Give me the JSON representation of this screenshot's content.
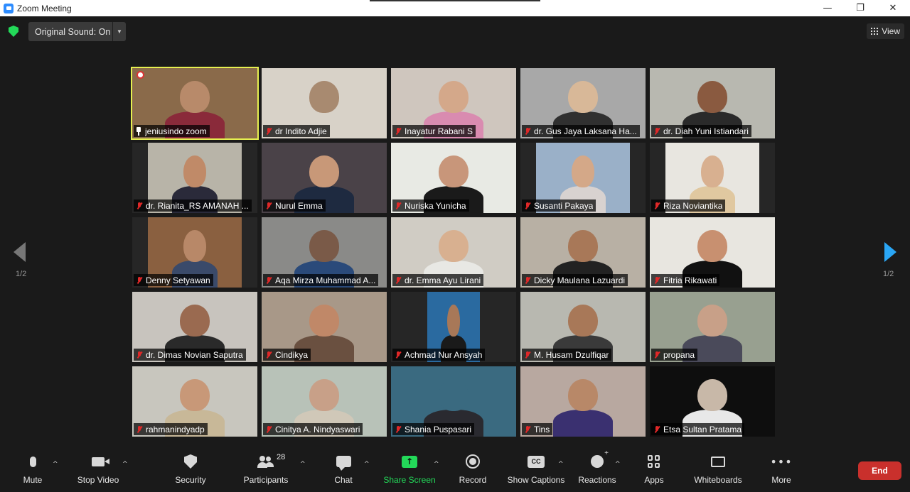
{
  "window": {
    "title": "Zoom Meeting",
    "minimize_glyph": "—",
    "restore_glyph": "❐",
    "close_glyph": "✕"
  },
  "topbar": {
    "original_sound_label": "Original Sound: On",
    "view_label": "View"
  },
  "gallery": {
    "page_indicator_left": "1/2",
    "page_indicator_right": "1/2",
    "participants": [
      {
        "name": "jeniusindo zoom",
        "muted": false,
        "pinned": true,
        "active_speaker": true,
        "bg": "#8a6a4a",
        "skin": "#b88a6a",
        "shirt": "#8a2a3a",
        "layout": "full"
      },
      {
        "name": "dr Indito Adjie",
        "muted": true,
        "bg": "#d8d2c8",
        "skin": "#a88a70",
        "shirt": "#d8d2c8",
        "layout": "full"
      },
      {
        "name": "Inayatur Rabani S",
        "muted": true,
        "bg": "#cfc6be",
        "skin": "#d4a88a",
        "shirt": "#d98bb0",
        "layout": "full"
      },
      {
        "name": "dr. Gus Jaya Laksana Ha...",
        "muted": true,
        "bg": "#a8a8a8",
        "skin": "#d8b898",
        "shirt": "#303030",
        "layout": "full"
      },
      {
        "name": "dr. Diah Yuni Istiandari",
        "muted": true,
        "bg": "#b8b8b0",
        "skin": "#8a5a40",
        "shirt": "#2a2a2a",
        "layout": "full"
      },
      {
        "name": "dr. Rianita_RS AMANAH ...",
        "muted": true,
        "bg": "#b8b4a8",
        "skin": "#c08a68",
        "shirt": "#2a2a3a",
        "layout": "narrow"
      },
      {
        "name": "Nurul Emma",
        "muted": true,
        "bg": "#4a4248",
        "skin": "#c89878",
        "shirt": "#1e2a40",
        "layout": "full"
      },
      {
        "name": "Nuriska Yunicha",
        "muted": true,
        "bg": "#e8eae4",
        "skin": "#c8967a",
        "shirt": "#1a1a1a",
        "layout": "full"
      },
      {
        "name": "Susanti Pakaya",
        "muted": true,
        "bg": "#9ab0c8",
        "skin": "#d4a888",
        "shirt": "#d8d2d0",
        "layout": "narrow"
      },
      {
        "name": "Riza Noviantika",
        "muted": true,
        "bg": "#e8e6e0",
        "skin": "#d8b090",
        "shirt": "#e0c8a0",
        "layout": "narrow"
      },
      {
        "name": "Denny Setyawan",
        "muted": true,
        "bg": "#8a6040",
        "skin": "#b88868",
        "shirt": "#3a4a6a",
        "layout": "narrow"
      },
      {
        "name": "Aqa Mirza Muhammad A...",
        "muted": true,
        "bg": "#8a8a88",
        "skin": "#7a5a48",
        "shirt": "#2a4a7a",
        "layout": "full"
      },
      {
        "name": "dr. Emma Ayu Lirani",
        "muted": true,
        "bg": "#d0ccc4",
        "skin": "#d8b090",
        "shirt": "#e8e8e4",
        "layout": "full"
      },
      {
        "name": "Dicky Maulana Lazuardi",
        "muted": true,
        "bg": "#b8b0a4",
        "skin": "#a87858",
        "shirt": "#222222",
        "layout": "full"
      },
      {
        "name": "Fitria Rikawati",
        "muted": true,
        "bg": "#e8e6e0",
        "skin": "#c89070",
        "shirt": "#111111",
        "layout": "full"
      },
      {
        "name": "dr. Dimas Novian Saputra",
        "muted": true,
        "bg": "#c8c4be",
        "skin": "#9a6a50",
        "shirt": "#2a2a2a",
        "layout": "full"
      },
      {
        "name": "Cindikya",
        "muted": true,
        "bg": "#a89888",
        "skin": "#c08868",
        "shirt": "#6a5040",
        "layout": "full"
      },
      {
        "name": "Achmad Nur Ansyah",
        "muted": true,
        "bg": "#2a6aa0",
        "skin": "#a87858",
        "shirt": "#1a1a1a",
        "layout": "narrower"
      },
      {
        "name": "M. Husam Dzulfiqar",
        "muted": true,
        "bg": "#b8b8b0",
        "skin": "#a87858",
        "shirt": "#3a3a3a",
        "layout": "full"
      },
      {
        "name": "propana",
        "muted": true,
        "bg": "#98a090",
        "skin": "#c8a088",
        "shirt": "#4a4a5a",
        "layout": "full"
      },
      {
        "name": "rahmanindyadp",
        "muted": true,
        "bg": "#c8c6be",
        "skin": "#c89878",
        "shirt": "#c8b898",
        "layout": "full"
      },
      {
        "name": "Cinitya A. Nindyaswari",
        "muted": true,
        "bg": "#b8c2b8",
        "skin": "#c8a088",
        "shirt": "#d0c8b8",
        "layout": "full"
      },
      {
        "name": "Shania Puspasari",
        "muted": true,
        "bg": "#3a6a80",
        "skin": "#3a6a80",
        "shirt": "#2a2a30",
        "layout": "full"
      },
      {
        "name": "Tins",
        "muted": true,
        "bg": "#b8a8a0",
        "skin": "#b88868",
        "shirt": "#3a3070",
        "layout": "full"
      },
      {
        "name": "Etsa Sultan Pratama",
        "muted": true,
        "bg": "#0e0e0e",
        "skin": "#c8b8a8",
        "shirt": "#e8e8e8",
        "layout": "full"
      }
    ]
  },
  "toolbar": {
    "mute_label": "Mute",
    "stop_video_label": "Stop Video",
    "security_label": "Security",
    "participants_label": "Participants",
    "participants_count": "28",
    "chat_label": "Chat",
    "share_screen_label": "Share Screen",
    "record_label": "Record",
    "show_captions_label": "Show Captions",
    "cc_text": "CC",
    "reactions_label": "Reactions",
    "apps_label": "Apps",
    "whiteboards_label": "Whiteboards",
    "more_label": "More",
    "more_glyph": "•••",
    "end_label": "End",
    "share_arrow": "↑",
    "caret_glyph": "^"
  },
  "colors": {
    "accent_green": "#23d959",
    "active_speaker_border": "#e6f050",
    "end_red": "#c9302c",
    "next_arrow_blue": "#2aa6f5"
  }
}
